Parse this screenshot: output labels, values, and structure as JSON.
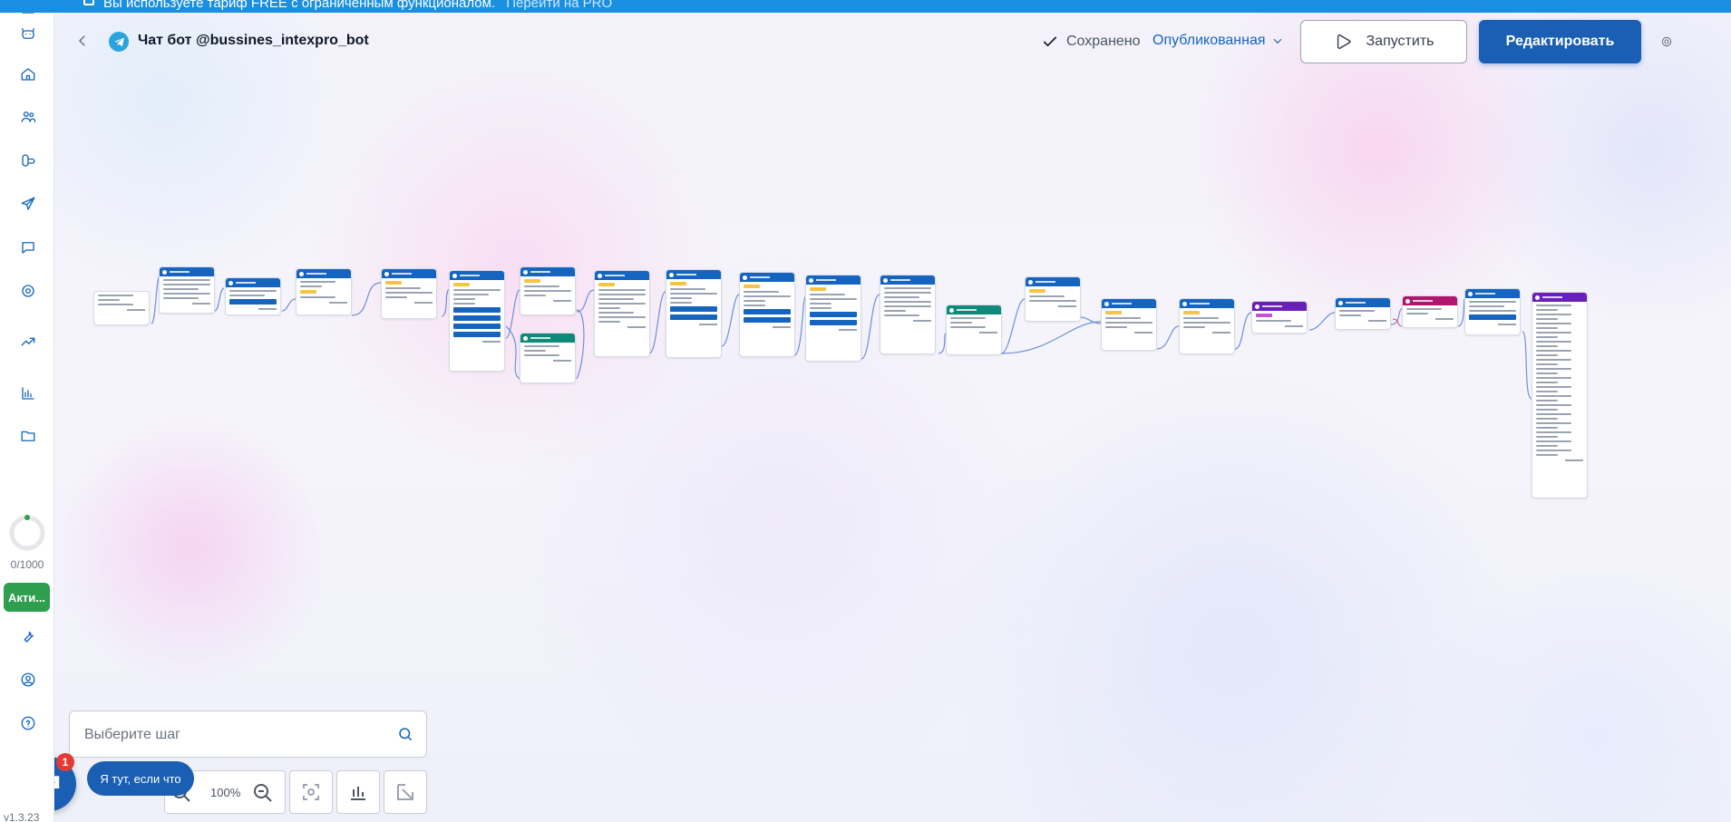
{
  "banner": {
    "text": "Вы используете тариф FREE с ограниченным функционалом.",
    "link": "Перейти на PRO"
  },
  "header": {
    "bot_title": "Чат бот @bussines_intexpro_bot",
    "saved_label": "Сохранено",
    "status_label": "Опубликованная",
    "run_label": "Запустить",
    "edit_label": "Редактировать"
  },
  "sidebar": {
    "items": [
      {
        "icon": "menu-icon"
      },
      {
        "icon": "bot-icon"
      },
      {
        "icon": "home-icon"
      },
      {
        "icon": "users-icon"
      },
      {
        "icon": "integrations-icon"
      },
      {
        "icon": "send-icon"
      },
      {
        "icon": "chat-icon"
      },
      {
        "icon": "settings-cog-icon"
      },
      {
        "icon": "trend-icon"
      },
      {
        "icon": "bar-chart-icon"
      },
      {
        "icon": "folder-icon"
      }
    ],
    "usage_counter": "0/1000",
    "active_badge": "Акти...",
    "bottom_icons": [
      "wrench-icon",
      "profile-icon",
      "help-icon"
    ],
    "version": "v1.3.23"
  },
  "canvas": {
    "search_placeholder": "Выберите шаг",
    "zoom_level": "100%"
  },
  "chat": {
    "unread_count": "1",
    "hint": "Я тут, если что"
  },
  "colors": {
    "primary": "#1565c0",
    "edit_button": "#1a5fb4",
    "banner": "#1a8ee0",
    "active_badge": "#2e9e4f",
    "node_teal": "#0f8a7a",
    "node_purple": "#6a1fb8",
    "node_magenta": "#b0166e"
  }
}
